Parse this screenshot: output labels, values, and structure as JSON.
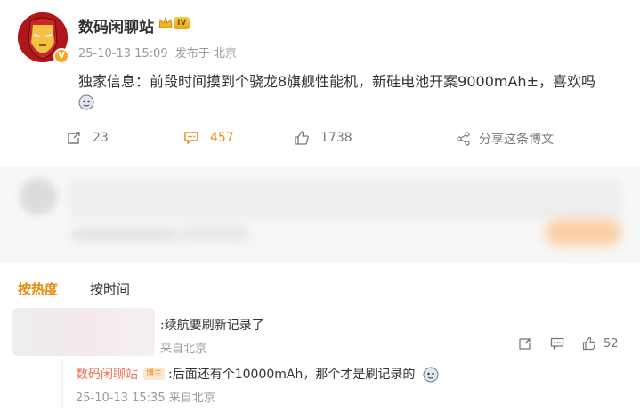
{
  "post": {
    "author": "数码闲聊站",
    "level_badge": "IV",
    "date": "25-10-13 15:09",
    "source": "发布于 北京",
    "text": "独家信息：前段时间摸到个骁龙8旗舰性能机，新硅电池开案9000mAh±，喜欢吗",
    "emoji_icon": "doge-icon"
  },
  "actions": {
    "repost_count": "23",
    "comment_count": "457",
    "like_count": "1738",
    "share_label": "分享这条博文"
  },
  "sort_tabs": {
    "hot": "按热度",
    "time": "按时间"
  },
  "comment": {
    "text": ":续航要刷新记录了",
    "meta": "来自北京",
    "like_count": "52"
  },
  "reply": {
    "name": "数码闲聊站",
    "badge": "博主",
    "text": ":后面还有个10000mAh，那个才是刷记录的",
    "date": "25-10-13 15:35",
    "location": "来自北京"
  },
  "colors": {
    "accent": "#e8890c",
    "name_link": "#eb7350",
    "muted": "#999999"
  }
}
